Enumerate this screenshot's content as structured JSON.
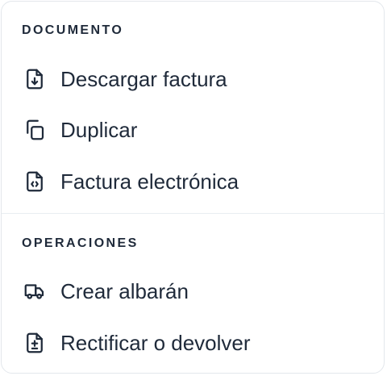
{
  "menu": {
    "sections": [
      {
        "title": "DOCUMENTO",
        "items": [
          {
            "label": "Descargar factura",
            "icon": "file-download-icon"
          },
          {
            "label": "Duplicar",
            "icon": "copy-icon"
          },
          {
            "label": "Factura electrónica",
            "icon": "file-code-icon"
          }
        ]
      },
      {
        "title": "OPERACIONES",
        "items": [
          {
            "label": "Crear albarán",
            "icon": "truck-icon"
          },
          {
            "label": "Rectificar o devolver",
            "icon": "file-plus-minus-icon"
          }
        ]
      }
    ]
  },
  "colors": {
    "text": "#1f2a3a",
    "border": "#e3e7ec",
    "background": "#ffffff"
  }
}
